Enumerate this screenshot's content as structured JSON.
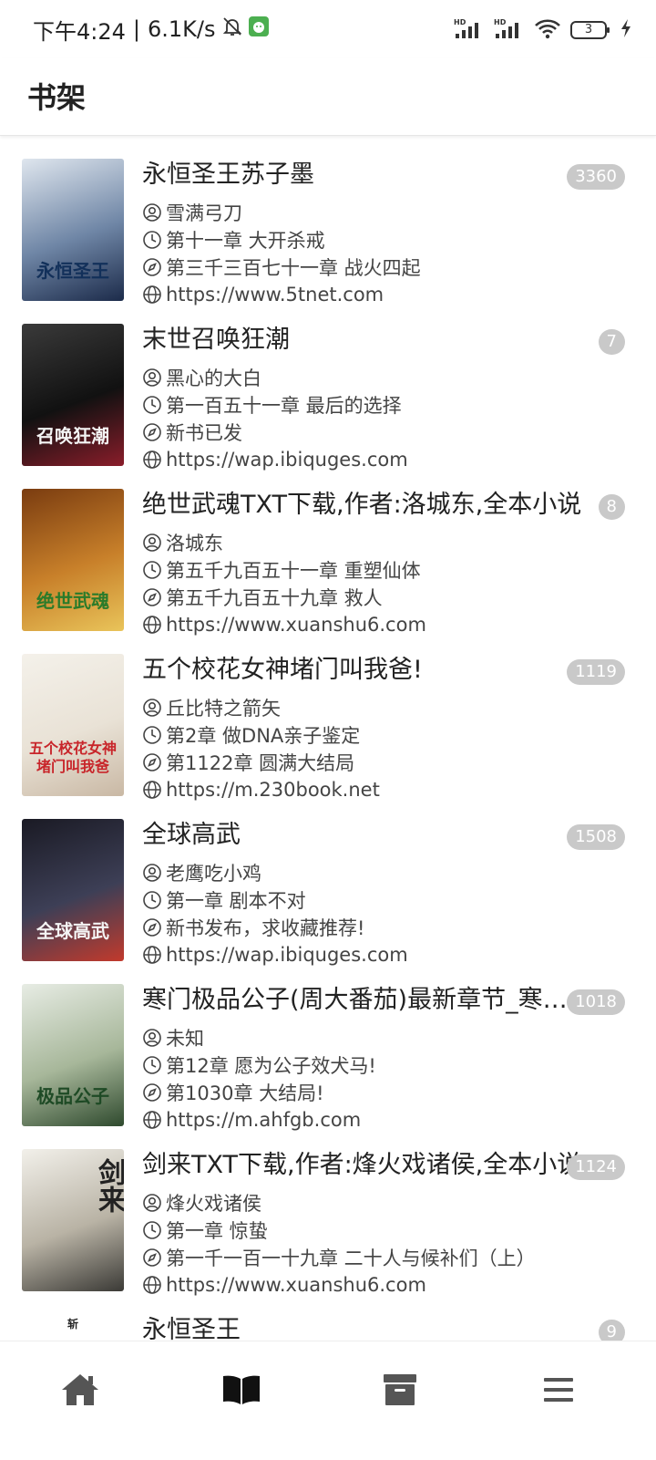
{
  "status_bar": {
    "time": "下午4:24",
    "net_speed": "6.1K/s",
    "battery_level": "3",
    "icons": [
      "mute-icon",
      "app-notification-icon",
      "hd-signal-icon",
      "hd-signal-icon",
      "wifi-icon",
      "battery-icon",
      "charging-icon"
    ]
  },
  "header": {
    "title": "书架"
  },
  "books": [
    {
      "title": "永恒圣王苏子墨",
      "author": "雪满弓刀",
      "read_chapter": "第十一章 大开杀戒",
      "latest_chapter": "第三千三百七十一章 战火四起",
      "source": "https://www.5tnet.com",
      "unread_count": "3360",
      "cover_text": "永恒圣王",
      "cover_colors": [
        "#dfe6ee",
        "#6f86a6",
        "#1c2b4a"
      ]
    },
    {
      "title": "末世召唤狂潮",
      "author": "黑心的大白",
      "read_chapter": "第一百五十一章 最后的选择",
      "latest_chapter": "新书已发",
      "source": "https://wap.ibiquges.com",
      "unread_count": "7",
      "cover_text": "召唤狂潮",
      "cover_colors": [
        "#3a3a3a",
        "#111111",
        "#8a1d2a"
      ]
    },
    {
      "title": "绝世武魂TXT下载,作者:洛城东,全本小说",
      "author": "洛城东",
      "read_chapter": "第五千九百五十一章 重塑仙体",
      "latest_chapter": "第五千九百五十九章 救人",
      "source": "https://www.xuanshu6.com",
      "unread_count": "8",
      "cover_text": "绝世武魂",
      "cover_colors": [
        "#7a3c10",
        "#c8802a",
        "#e9c45a"
      ]
    },
    {
      "title": "五个校花女神堵门叫我爸!",
      "author": "丘比特之箭矢",
      "read_chapter": "第2章 做DNA亲子鉴定",
      "latest_chapter": "第1122章 圆满大结局",
      "source": "https://m.230book.net",
      "unread_count": "1119",
      "cover_text": "五个校花女神堵门叫我爸",
      "cover_colors": [
        "#f4f1ea",
        "#e9e2d6",
        "#c9b8a4"
      ]
    },
    {
      "title": "全球高武",
      "author": "老鹰吃小鸡",
      "read_chapter": "第一章 剧本不对",
      "latest_chapter": "新书发布，求收藏推荐!",
      "source": "https://wap.ibiquges.com",
      "unread_count": "1508",
      "cover_text": "全球高武",
      "cover_colors": [
        "#1a1a24",
        "#3d3f56",
        "#c23a2c"
      ]
    },
    {
      "title": "寒门极品公子(周大番茄)最新章节_寒门极品公子",
      "author": "未知",
      "read_chapter": "第12章 愿为公子效犬马!",
      "latest_chapter": "第1030章 大结局!",
      "source": "https://m.ahfgb.com",
      "unread_count": "1018",
      "cover_text": "极品公子",
      "cover_colors": [
        "#e7ece4",
        "#a7b79a",
        "#2f4a2e"
      ]
    },
    {
      "title": "剑来TXT下载,作者:烽火戏诸侯,全本小说",
      "author": "烽火戏诸侯",
      "read_chapter": "第一章 惊蛰",
      "latest_chapter": "第一千一百一十九章 二十人与候补们（上）",
      "source": "https://www.xuanshu6.com",
      "unread_count": "1124",
      "cover_text": "剑来",
      "cover_colors": [
        "#f2f0ea",
        "#b9b3a5",
        "#3b3a36"
      ]
    },
    {
      "title": "永恒圣王",
      "author": "",
      "read_chapter": "",
      "latest_chapter": "",
      "source": "",
      "unread_count": "9",
      "cover_text": "斩",
      "cover_colors": [
        "#ffffff",
        "#ffffff",
        "#ffffff"
      ]
    }
  ],
  "bottom_nav": {
    "items": [
      "home-icon",
      "bookshelf-icon",
      "archive-icon",
      "menu-icon"
    ],
    "active_color": "#111111",
    "inactive_color": "#555555"
  }
}
